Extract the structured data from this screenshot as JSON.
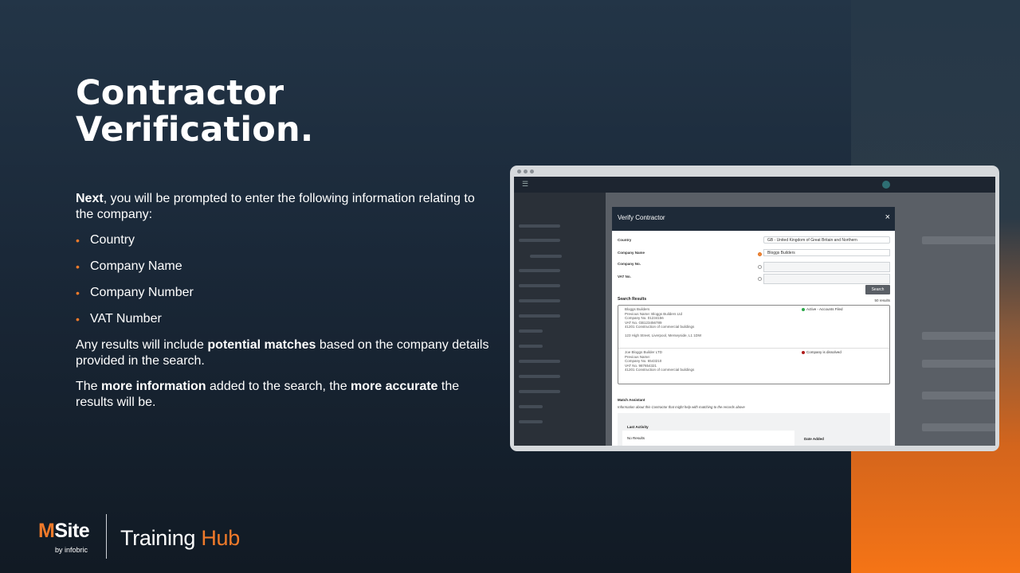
{
  "slide": {
    "title": "Contractor Verification.",
    "intro_bold": "Next",
    "intro_rest": ", you will be prompted to enter the following information relating to the company:",
    "bullets": [
      "Country",
      "Company Name",
      "Company Number",
      "VAT Number"
    ],
    "para2_a": "Any results will include ",
    "para2_b": "potential matches",
    "para2_c": " based on the company details provided in the search.",
    "para3_a": "The ",
    "para3_b": "more information",
    "para3_c": " added to the search, the ",
    "para3_d": "more accurate",
    "para3_e": " the results will be."
  },
  "modal": {
    "title": "Verify Contractor",
    "close": "×",
    "country_label": "Country",
    "country_value": "GB - United Kingdom of Great Britain and Northern",
    "company_name_label": "Company Name",
    "company_name_value": "Bloggs Builders",
    "company_no_label": "Company No.",
    "vat_label": "VAT No.",
    "search_button": "Search",
    "results_label": "Search Results",
    "results_count": "50 results",
    "results": [
      {
        "name": "Bloggs Builders",
        "previous": "Previous Name: Bloggs Builders Ltd",
        "company_no": "Company No. 01234156",
        "vat": "VAT No. GB123456789",
        "sic": "41201 Construction of commercial buildings",
        "address": "123 High Street, Liverpool, Merseyside, L1 1DW",
        "status": "Active - Accounts Filed",
        "status_color": "#2ca84a"
      },
      {
        "name": "Joe Bloggs Builder LTD",
        "previous": "Previous Name:",
        "company_no": "Company No. 6543210",
        "vat": "VAT No. 987654321",
        "sic": "41201 Construction of commercial buildings",
        "address": "",
        "status": "Company is dissolved",
        "status_color": "#b01c1c"
      }
    ],
    "match_label": "Match Assistant",
    "match_sub": "Information about this Contractor that might help with matching to the records above",
    "last_activity": "Last Activity",
    "no_results": "No Results",
    "date_added": "Date Added"
  },
  "footer": {
    "brand_m": "M",
    "brand_rest": "Site",
    "byline": "by infobric",
    "hub_a": "Training ",
    "hub_b": "Hub"
  }
}
